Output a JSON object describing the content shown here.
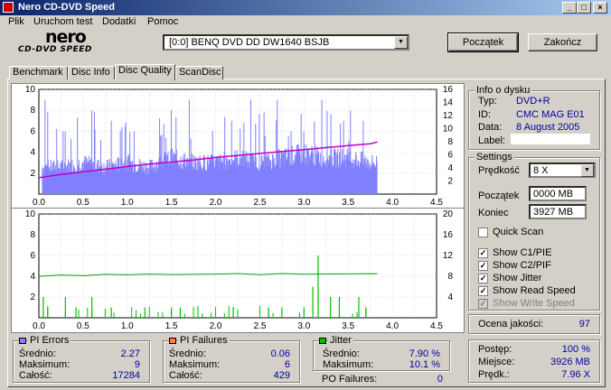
{
  "window": {
    "title": "Nero CD-DVD Speed"
  },
  "menu": {
    "items": [
      "Plik",
      "Uruchom test",
      "Dodatki",
      "Pomoc"
    ]
  },
  "logo": {
    "main": "nero",
    "sub": "CD-DVD SPEED"
  },
  "drive": {
    "selected": "[0:0]  BENQ DVD DD DW1640 BSJB"
  },
  "buttons": {
    "start": "Początek",
    "exit": "Zakończ"
  },
  "tabs": [
    "Benchmark",
    "Disc Info",
    "Disc Quality",
    "ScanDisc"
  ],
  "info": {
    "title": "Info o dysku",
    "type_label": "Typ:",
    "type_value": "DVD+R",
    "id_label": "ID:",
    "id_value": "CMC MAG E01",
    "date_label": "Data:",
    "date_value": "8 August 2005",
    "label_label": "Label:",
    "label_value": ""
  },
  "settings": {
    "title": "Settings",
    "speed_label": "Prędkość",
    "speed_value": "8 X",
    "start_label": "Początek",
    "start_value": "0000 MB",
    "end_label": "Koniec",
    "end_value": "3927 MB",
    "quick_scan": "Quick Scan",
    "quick_scan_checked": false,
    "options": [
      {
        "label": "Show C1/PIE",
        "checked": true,
        "enabled": true
      },
      {
        "label": "Show C2/PIF",
        "checked": true,
        "enabled": true
      },
      {
        "label": "Show Jitter",
        "checked": true,
        "enabled": true
      },
      {
        "label": "Show Read Speed",
        "checked": true,
        "enabled": true
      },
      {
        "label": "Show Write Speed",
        "checked": true,
        "enabled": false
      }
    ]
  },
  "quality": {
    "label": "Ocena jakości:",
    "value": "97"
  },
  "progress": {
    "progress_label": "Postęp:",
    "progress_value": "100 %",
    "position_label": "Miejsce:",
    "position_value": "3926 MB",
    "speed_label": "Prędk.:",
    "speed_value": "7.96 X"
  },
  "pi_errors": {
    "title": "PI Errors",
    "avg_label": "Średnio:",
    "avg": "2.27",
    "max_label": "Maksimum:",
    "max": "9",
    "total_label": "Całość:",
    "total": "17284",
    "color": "#8080ff"
  },
  "pi_failures": {
    "title": "PI Failures",
    "avg_label": "Średnio:",
    "avg": "0.06",
    "max_label": "Maksimum:",
    "max": "6",
    "total_label": "Całość:",
    "total": "429",
    "color": "#ff8040"
  },
  "jitter": {
    "title": "Jitter",
    "avg_label": "Średnio:",
    "avg": "7.90 %",
    "max_label": "Maksimum:",
    "max": "10.1 %",
    "color": "#00c000"
  },
  "po_failures": {
    "label": "PO Failures:",
    "value": "0"
  },
  "colors": {
    "pie": "#8080ff",
    "read_speed": "#c000c0",
    "pif": "#00c000",
    "jitter": "#00a000"
  },
  "chart_data": [
    {
      "type": "area",
      "name_hint": "PI errors and read speed",
      "x": [
        0.0,
        0.25,
        0.5,
        0.75,
        1.0,
        1.25,
        1.5,
        1.75,
        2.0,
        2.25,
        2.5,
        2.75,
        3.0,
        3.25,
        3.5,
        3.75,
        3.83
      ],
      "series": [
        {
          "values": [
            3,
            3,
            3.5,
            3,
            3.5,
            3,
            4,
            3.5,
            3.5,
            4,
            3.5,
            4,
            4.5,
            4,
            4,
            3.5,
            3.5
          ]
        },
        {
          "values": [
            2.5,
            3.0,
            3.4,
            3.8,
            4.2,
            4.6,
            4.9,
            5.2,
            5.6,
            5.9,
            6.2,
            6.5,
            6.8,
            7.1,
            7.4,
            7.7,
            7.96
          ]
        }
      ],
      "peaks": [
        [
          0.07,
          9
        ],
        [
          0.3,
          6
        ],
        [
          0.6,
          8
        ],
        [
          0.82,
          7
        ],
        [
          1.08,
          6
        ],
        [
          1.5,
          8
        ],
        [
          1.7,
          9
        ],
        [
          2.18,
          7
        ],
        [
          2.4,
          9
        ],
        [
          2.7,
          9
        ],
        [
          3.0,
          6
        ],
        [
          3.2,
          9
        ],
        [
          3.45,
          7
        ],
        [
          3.67,
          7
        ]
      ],
      "xlim": [
        0.0,
        4.5
      ],
      "ylim": [
        0,
        10
      ],
      "y2lim": [
        0,
        16
      ],
      "xticks": [
        "0.0",
        "0.5",
        "1.0",
        "1.5",
        "2.0",
        "2.5",
        "3.0",
        "3.5",
        "4.0",
        "4.5"
      ],
      "yticks": [
        "2",
        "4",
        "6",
        "8",
        "10"
      ],
      "y2ticks": [
        "2",
        "4",
        "6",
        "8",
        "10",
        "12",
        "14",
        "16"
      ]
    },
    {
      "type": "bar",
      "name_hint": "PI failures and jitter",
      "x": [
        0.0,
        0.25,
        0.5,
        0.75,
        1.0,
        1.25,
        1.5,
        1.75,
        2.0,
        2.25,
        2.5,
        2.75,
        3.0,
        3.25,
        3.5,
        3.75,
        3.83
      ],
      "series": [
        {
          "values": [
            8.0,
            8.1,
            8.2,
            8.3,
            8.2,
            8.3,
            8.4,
            8.4,
            8.4,
            8.5,
            8.4,
            8.5,
            8.5,
            8.4,
            8.5,
            8.6,
            8.6
          ]
        }
      ],
      "bars": [
        [
          0.05,
          2
        ],
        [
          0.1,
          1
        ],
        [
          0.3,
          2
        ],
        [
          0.42,
          1
        ],
        [
          0.6,
          2
        ],
        [
          0.82,
          1
        ],
        [
          1.2,
          1
        ],
        [
          1.5,
          1
        ],
        [
          1.6,
          1
        ],
        [
          2.2,
          1
        ],
        [
          2.6,
          1
        ],
        [
          2.75,
          1
        ],
        [
          3.0,
          1
        ],
        [
          3.1,
          3
        ],
        [
          3.16,
          6
        ],
        [
          3.3,
          2
        ],
        [
          3.4,
          2
        ],
        [
          3.62,
          2
        ],
        [
          3.7,
          1
        ]
      ],
      "xlim": [
        0.0,
        4.5
      ],
      "ylim": [
        0,
        10
      ],
      "y2lim": [
        0,
        20
      ],
      "xticks": [
        "0.0",
        "0.5",
        "1.0",
        "1.5",
        "2.0",
        "2.5",
        "3.0",
        "3.5",
        "4.0",
        "4.5"
      ],
      "yticks": [
        "2",
        "4",
        "6",
        "8",
        "10"
      ],
      "y2ticks": [
        "4",
        "8",
        "12",
        "16",
        "20"
      ]
    }
  ]
}
